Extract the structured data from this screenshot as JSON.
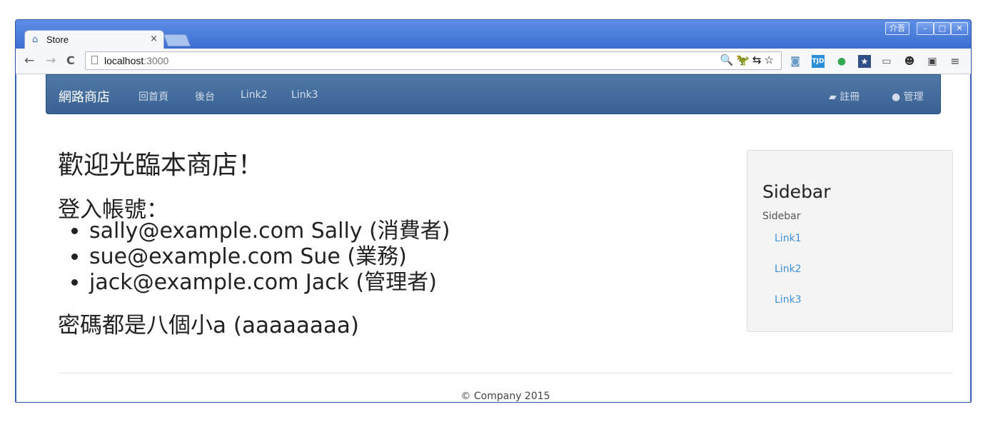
{
  "window": {
    "ime_label": "介吾",
    "controls": [
      "–",
      "□",
      "✕"
    ]
  },
  "tab": {
    "title": "Store",
    "close": "×"
  },
  "toolbar": {
    "back": "←",
    "forward": "→",
    "reload": "C",
    "url_host": "localhost",
    "url_port": ":3000",
    "omni_icons": "🔍🦖⇆☆"
  },
  "extensions": [
    "camera-icon",
    "tjd-icon",
    "leaf-icon",
    "star-badge-icon",
    "cast-icon",
    "cat-icon",
    "wallet-icon",
    "menu-icon"
  ],
  "navbar": {
    "brand": "網路商店",
    "links": [
      "回首頁",
      "後台",
      "Link2",
      "Link3"
    ],
    "register": "註冊",
    "admin": "管理",
    "color": "#3e6596"
  },
  "main": {
    "welcome": "歡迎光臨本商店！",
    "login_title": "登入帳號：",
    "accounts": [
      "sally@example.com Sally (消費者)",
      "sue@example.com Sue (業務)",
      "jack@example.com Jack (管理者)"
    ],
    "password_note": "密碼都是八個小a (aaaaaaaa)"
  },
  "sidebar": {
    "heading": "Sidebar",
    "sub": "Sidebar",
    "links": [
      "Link1",
      "Link2",
      "Link3"
    ]
  },
  "footer": {
    "text": "© Company 2015"
  }
}
